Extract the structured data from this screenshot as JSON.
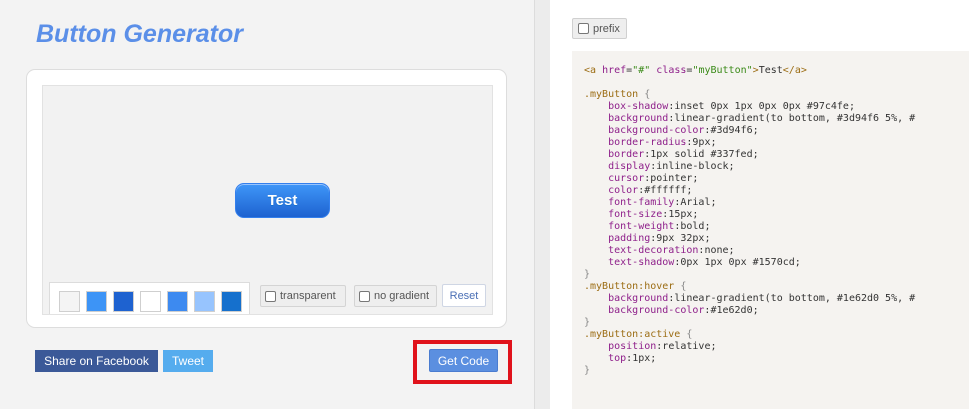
{
  "app": {
    "title": "Button Generator"
  },
  "preview": {
    "button_label": "Test"
  },
  "swatches": [
    {
      "color": "#f4f4f4"
    },
    {
      "color": "#3d94f6"
    },
    {
      "color": "#1e62d0"
    },
    {
      "color": "#ffffff"
    },
    {
      "color": "#3d8af0"
    },
    {
      "color": "#97c4fe"
    },
    {
      "color": "#1570cd"
    }
  ],
  "options": {
    "transparent_label": "transparent",
    "no_gradient_label": "no gradient",
    "reset_label": "Reset"
  },
  "actions": {
    "facebook_label": "Share on Facebook",
    "tweet_label": "Tweet",
    "get_code_label": "Get Code"
  },
  "code_panel": {
    "prefix_label": "prefix",
    "html_line": {
      "open": "<a",
      "attr1": "href",
      "val1": "\"#\"",
      "attr2": "class",
      "val2": "\"myButton\"",
      "close_open": ">",
      "text": "Test",
      "close_tag": "</a>"
    },
    "css_blocks": [
      {
        "selector": ".myButton",
        "props": [
          {
            "k": "box-shadow",
            "v": "inset 0px 1px 0px 0px #97c4fe;"
          },
          {
            "k": "background",
            "v": "linear-gradient(to bottom, #3d94f6 5%, #"
          },
          {
            "k": "background-color",
            "v": "#3d94f6;"
          },
          {
            "k": "border-radius",
            "v": "9px;"
          },
          {
            "k": "border",
            "v": "1px solid #337fed;"
          },
          {
            "k": "display",
            "v": "inline-block;"
          },
          {
            "k": "cursor",
            "v": "pointer;"
          },
          {
            "k": "color",
            "v": "#ffffff;"
          },
          {
            "k": "font-family",
            "v": "Arial;"
          },
          {
            "k": "font-size",
            "v": "15px;"
          },
          {
            "k": "font-weight",
            "v": "bold;"
          },
          {
            "k": "padding",
            "v": "9px 32px;"
          },
          {
            "k": "text-decoration",
            "v": "none;"
          },
          {
            "k": "text-shadow",
            "v": "0px 1px 0px #1570cd;"
          }
        ]
      },
      {
        "selector": ".myButton:hover",
        "props": [
          {
            "k": "background",
            "v": "linear-gradient(to bottom, #1e62d0 5%, #"
          },
          {
            "k": "background-color",
            "v": "#1e62d0;"
          }
        ]
      },
      {
        "selector": ".myButton:active",
        "props": [
          {
            "k": "position",
            "v": "relative;"
          },
          {
            "k": "top",
            "v": "1px;"
          }
        ]
      }
    ]
  }
}
